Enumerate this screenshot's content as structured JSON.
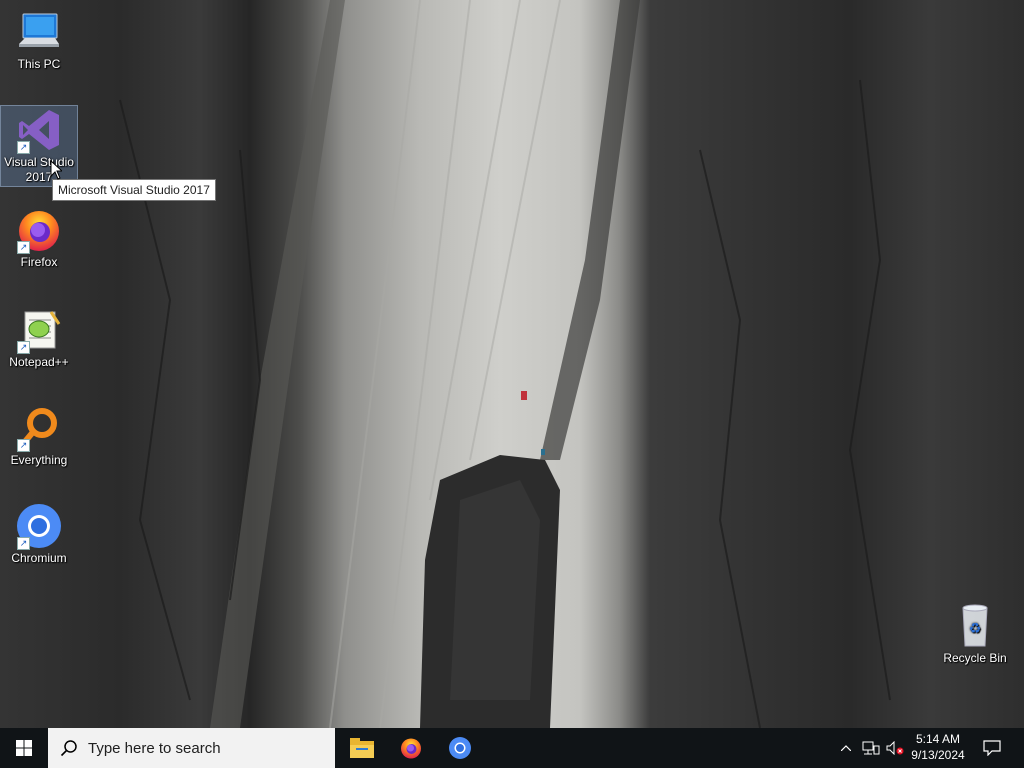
{
  "desktop": {
    "icons": [
      {
        "label": "This PC",
        "icon": "this-pc-icon"
      },
      {
        "label": "Visual Studio 2017",
        "icon": "visual-studio-icon"
      },
      {
        "label": "Firefox",
        "icon": "firefox-icon"
      },
      {
        "label": "Notepad++",
        "icon": "notepadpp-icon"
      },
      {
        "label": "Everything",
        "icon": "everything-icon"
      },
      {
        "label": "Chromium",
        "icon": "chromium-icon"
      },
      {
        "label": "Recycle Bin",
        "icon": "recycle-bin-icon"
      }
    ],
    "tooltip": "Microsoft Visual Studio 2017",
    "selected_icon": "Visual Studio 2017"
  },
  "taskbar": {
    "search_placeholder": "Type here to search",
    "pinned": [
      {
        "name": "File Explorer",
        "icon": "file-explorer-icon"
      },
      {
        "name": "Firefox",
        "icon": "firefox-icon"
      },
      {
        "name": "Chromium",
        "icon": "chromium-icon"
      }
    ],
    "tray_icons": [
      "chevron-up-icon",
      "network-icon",
      "volume-muted-icon",
      "notification-icon"
    ],
    "time": "5:14 AM",
    "date": "9/13/2024"
  },
  "colors": {
    "taskbar": "#101417",
    "search_box": "#f2f2f2",
    "selection": "#78a0dc"
  }
}
